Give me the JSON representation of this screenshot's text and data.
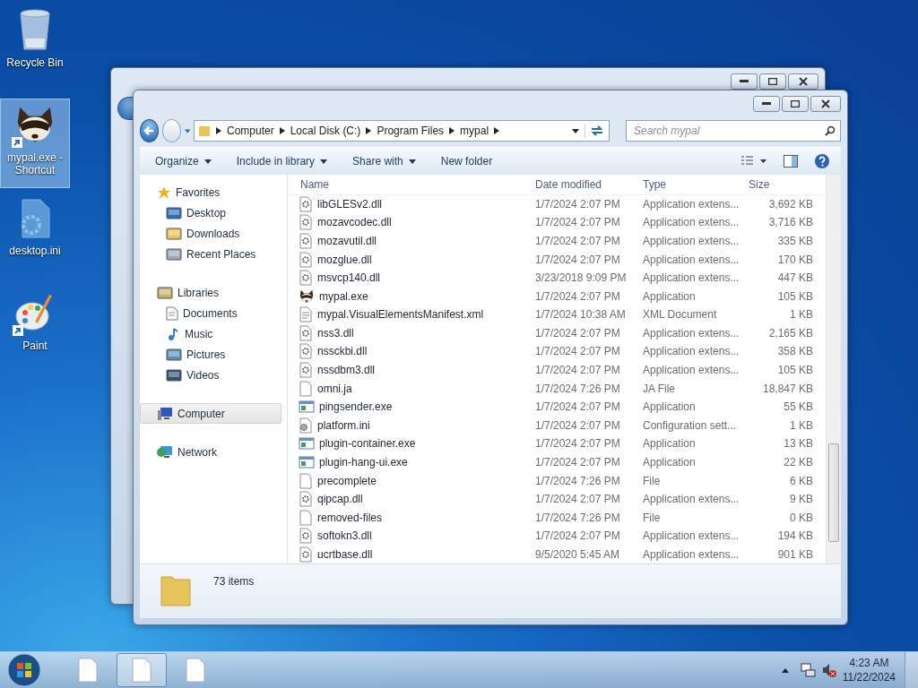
{
  "desktop_icons": [
    {
      "label": "Recycle Bin",
      "kind": "recycle",
      "selected": false,
      "shortcut": false
    },
    {
      "label": "mypal.exe - Shortcut",
      "kind": "raccoon",
      "selected": true,
      "shortcut": true
    },
    {
      "label": "desktop.ini",
      "kind": "settings-file",
      "selected": false,
      "shortcut": false
    },
    {
      "label": "Paint",
      "kind": "paint",
      "selected": false,
      "shortcut": true
    }
  ],
  "window": {
    "address": [
      "Computer",
      "Local Disk (C:)",
      "Program Files",
      "mypal"
    ],
    "search": {
      "placeholder": "Search mypal"
    },
    "toolbar": [
      {
        "label": "Organize",
        "dropdown": true
      },
      {
        "label": "Include in library",
        "dropdown": true
      },
      {
        "label": "Share with",
        "dropdown": true
      },
      {
        "label": "New folder",
        "dropdown": false
      }
    ],
    "nav": [
      {
        "label": "Favorites",
        "kind": "star",
        "selected": false,
        "children": [
          {
            "label": "Desktop",
            "kind": "desktop",
            "selected": false
          },
          {
            "label": "Downloads",
            "kind": "downloads",
            "selected": false
          },
          {
            "label": "Recent Places",
            "kind": "recent",
            "selected": false
          }
        ]
      },
      {
        "label": "Libraries",
        "kind": "library",
        "selected": false,
        "children": [
          {
            "label": "Documents",
            "kind": "documents",
            "selected": false
          },
          {
            "label": "Music",
            "kind": "music",
            "selected": false
          },
          {
            "label": "Pictures",
            "kind": "pictures",
            "selected": false
          },
          {
            "label": "Videos",
            "kind": "videos",
            "selected": false
          }
        ]
      },
      {
        "label": "Computer",
        "kind": "computer",
        "selected": true
      },
      {
        "label": "Network",
        "kind": "network",
        "selected": false
      }
    ],
    "columns": [
      "Name",
      "Date modified",
      "Type",
      "Size"
    ],
    "rows": [
      {
        "name": "libGLESv2.dll",
        "date": "1/7/2024 2:07 PM",
        "type": "Application extens...",
        "size": "3,692 KB",
        "kind": "dll"
      },
      {
        "name": "mozavcodec.dll",
        "date": "1/7/2024 2:07 PM",
        "type": "Application extens...",
        "size": "3,716 KB",
        "kind": "dll"
      },
      {
        "name": "mozavutil.dll",
        "date": "1/7/2024 2:07 PM",
        "type": "Application extens...",
        "size": "335 KB",
        "kind": "dll"
      },
      {
        "name": "mozglue.dll",
        "date": "1/7/2024 2:07 PM",
        "type": "Application extens...",
        "size": "170 KB",
        "kind": "dll"
      },
      {
        "name": "msvcp140.dll",
        "date": "3/23/2018 9:09 PM",
        "type": "Application extens...",
        "size": "447 KB",
        "kind": "dll"
      },
      {
        "name": "mypal.exe",
        "date": "1/7/2024 2:07 PM",
        "type": "Application",
        "size": "105 KB",
        "kind": "raccoon"
      },
      {
        "name": "mypal.VisualElementsManifest.xml",
        "date": "1/7/2024 10:38 AM",
        "type": "XML Document",
        "size": "1 KB",
        "kind": "xml"
      },
      {
        "name": "nss3.dll",
        "date": "1/7/2024 2:07 PM",
        "type": "Application extens...",
        "size": "2,165 KB",
        "kind": "dll"
      },
      {
        "name": "nssckbi.dll",
        "date": "1/7/2024 2:07 PM",
        "type": "Application extens...",
        "size": "358 KB",
        "kind": "dll"
      },
      {
        "name": "nssdbm3.dll",
        "date": "1/7/2024 2:07 PM",
        "type": "Application extens...",
        "size": "105 KB",
        "kind": "dll"
      },
      {
        "name": "omni.ja",
        "date": "1/7/2024 7:26 PM",
        "type": "JA File",
        "size": "18,847 KB",
        "kind": "blank"
      },
      {
        "name": "pingsender.exe",
        "date": "1/7/2024 2:07 PM",
        "type": "Application",
        "size": "55 KB",
        "kind": "exe"
      },
      {
        "name": "platform.ini",
        "date": "1/7/2024 2:07 PM",
        "type": "Configuration sett...",
        "size": "1 KB",
        "kind": "ini"
      },
      {
        "name": "plugin-container.exe",
        "date": "1/7/2024 2:07 PM",
        "type": "Application",
        "size": "13 KB",
        "kind": "exe"
      },
      {
        "name": "plugin-hang-ui.exe",
        "date": "1/7/2024 2:07 PM",
        "type": "Application",
        "size": "22 KB",
        "kind": "exe"
      },
      {
        "name": "precomplete",
        "date": "1/7/2024 7:26 PM",
        "type": "File",
        "size": "6 KB",
        "kind": "blank"
      },
      {
        "name": "qipcap.dll",
        "date": "1/7/2024 2:07 PM",
        "type": "Application extens...",
        "size": "9 KB",
        "kind": "dll"
      },
      {
        "name": "removed-files",
        "date": "1/7/2024 7:26 PM",
        "type": "File",
        "size": "0 KB",
        "kind": "blank"
      },
      {
        "name": "softokn3.dll",
        "date": "1/7/2024 2:07 PM",
        "type": "Application extens...",
        "size": "194 KB",
        "kind": "dll"
      },
      {
        "name": "ucrtbase.dll",
        "date": "9/5/2020 5:45 AM",
        "type": "Application extens...",
        "size": "901 KB",
        "kind": "dll"
      }
    ],
    "status": "73 items"
  },
  "taskbar": {
    "buttons": [
      {
        "selected": false
      },
      {
        "selected": true
      },
      {
        "selected": false
      }
    ],
    "time": "4:23 AM",
    "date": "11/22/2024"
  }
}
